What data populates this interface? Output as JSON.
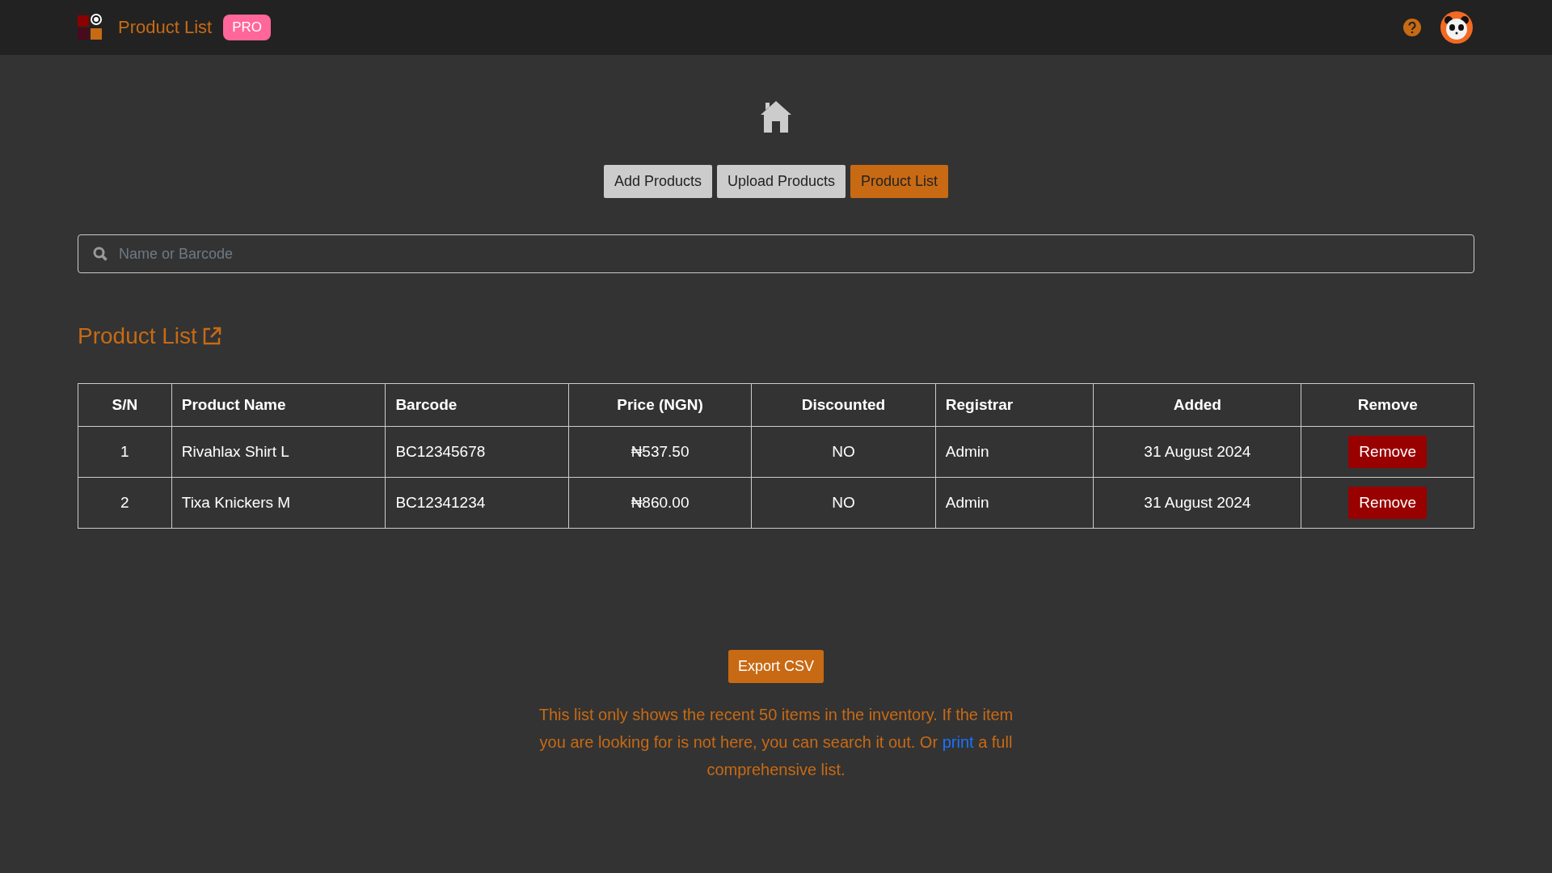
{
  "header": {
    "title": "Product List",
    "badge": "PRO"
  },
  "nav_buttons": [
    {
      "label": "Add Products",
      "selected": false
    },
    {
      "label": "Upload Products",
      "selected": false
    },
    {
      "label": "Product List",
      "selected": true
    }
  ],
  "search": {
    "placeholder": "Name or Barcode"
  },
  "section_title": "Product List",
  "table": {
    "columns": [
      "S/N",
      "Product Name",
      "Barcode",
      "Price (NGN)",
      "Discounted",
      "Registrar",
      "Added",
      "Remove"
    ],
    "rows": [
      {
        "sn": "1",
        "name": "Rivahlax Shirt L",
        "barcode": "BC12345678",
        "price": "₦537.50",
        "discounted": "NO",
        "registrar": "Admin",
        "added": "31 August 2024",
        "action": "Remove"
      },
      {
        "sn": "2",
        "name": "Tixa Knickers M",
        "barcode": "BC12341234",
        "price": "₦860.00",
        "discounted": "NO",
        "registrar": "Admin",
        "added": "31 August 2024",
        "action": "Remove"
      }
    ]
  },
  "export_button": "Export CSV",
  "note": {
    "text": "This list only shows the recent 50 items in the inventory. If the item you are looking for is not here, you can search it out. Or",
    "link": "print",
    "after": "a full comprehensive list."
  }
}
